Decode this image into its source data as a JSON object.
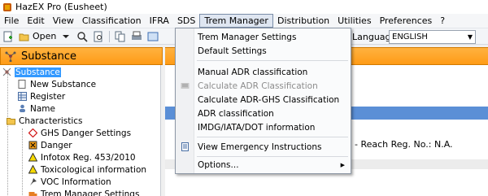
{
  "window": {
    "title": "HazEX Pro (Eusheet)"
  },
  "menubar": {
    "items": [
      "File",
      "Edit",
      "View",
      "Classification",
      "IFRA",
      "SDS",
      "Trem Manager",
      "Distribution",
      "Utilities",
      "Preferences",
      "?"
    ]
  },
  "toolbar": {
    "open_label": "Open",
    "language_label": "Language",
    "language_value": "ENGLISH"
  },
  "substance_panel": {
    "title": "Substance",
    "tree": [
      {
        "label": "Substance",
        "icon": "tree-root-icon",
        "selected": true
      },
      {
        "label": "New Substance",
        "icon": "document-icon"
      },
      {
        "label": "Register",
        "icon": "grid-icon"
      },
      {
        "label": "Name",
        "icon": "name-icon"
      },
      {
        "label": "Characteristics",
        "icon": "folder-icon"
      },
      {
        "label": "GHS Danger Settings",
        "icon": "ghs-diamond-icon"
      },
      {
        "label": "Danger",
        "icon": "danger-icon"
      },
      {
        "label": "Infotox Reg. 453/2010",
        "icon": "warning-triangle-icon"
      },
      {
        "label": "Toxicological information",
        "icon": "warning-triangle-icon"
      },
      {
        "label": "VOC Information",
        "icon": "pin-icon"
      },
      {
        "label": "Trem Manager Settings",
        "icon": "truck-icon"
      }
    ]
  },
  "content": {
    "reach_text": "- Reach Reg. No.: N.A."
  },
  "trem_menu": {
    "items": [
      {
        "label": "Trem Manager Settings"
      },
      {
        "label": "Default Settings"
      },
      {
        "label": "Manual ADR classification"
      },
      {
        "label": "Calculate ADR Classification",
        "disabled": true
      },
      {
        "label": "Calculate ADR-GHS Classification"
      },
      {
        "label": "ADR classification"
      },
      {
        "label": "IMDG/IATA/DOT information"
      },
      {
        "label": "View Emergency Instructions"
      },
      {
        "label": "Options..."
      }
    ]
  },
  "colors": {
    "orange_header": "#ff9b16",
    "selection_blue": "#3399ff",
    "content_blue_strip": "#5b8fd6"
  }
}
